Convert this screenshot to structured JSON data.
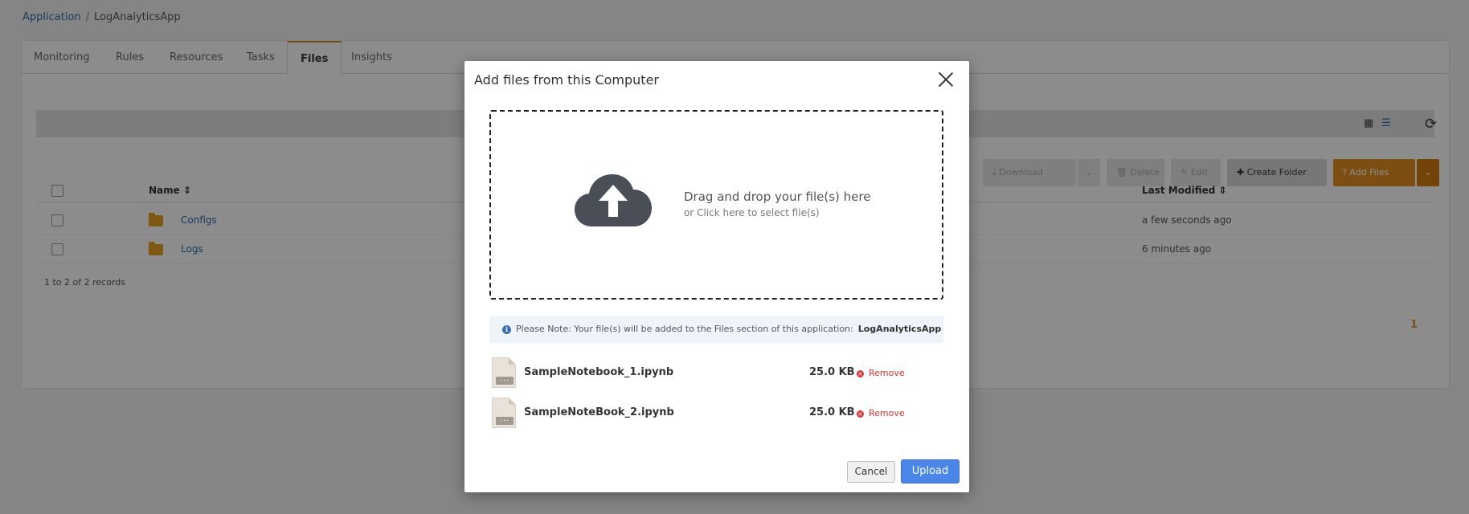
{
  "breadcrumb": {
    "root": "Application",
    "separator": "/",
    "current": "LogAnalyticsApp"
  },
  "tabs": [
    {
      "label": "Monitoring"
    },
    {
      "label": "Rules"
    },
    {
      "label": "Resources"
    },
    {
      "label": "Tasks"
    },
    {
      "label": "Files",
      "active": true
    },
    {
      "label": "Insights"
    }
  ],
  "actions": {
    "download": "Download",
    "delete": "Delete",
    "edit": "Edit",
    "create_folder": "Create Folder",
    "add_files": "Add Files"
  },
  "table": {
    "columns": {
      "name": "Name",
      "last_modified": "Last Modified"
    },
    "rows": [
      {
        "name": "Configs",
        "last_modified": "a few seconds ago"
      },
      {
        "name": "Logs",
        "last_modified": "6 minutes ago"
      }
    ],
    "records": "1 to 2 of 2 records",
    "page": "1"
  },
  "modal": {
    "title": "Add files from this Computer",
    "drop_primary": "Drag and drop your file(s) here",
    "drop_secondary": "or Click here to select file(s)",
    "note_text": "Please Note: Your file(s) will be added to the Files section of this application:",
    "note_app": "LogAnalyticsApp",
    "files": [
      {
        "name": "SampleNotebook_1.ipynb",
        "size": "25.0 KB",
        "remove": "Remove"
      },
      {
        "name": "SampleNoteBook_2.ipynb",
        "size": "25.0 KB",
        "remove": "Remove"
      }
    ],
    "cancel": "Cancel",
    "upload": "Upload"
  },
  "colors": {
    "accent": "#e48f1f",
    "primary_button": "#4a86e8",
    "remove": "#dd3333",
    "link": "#2d6db5"
  }
}
